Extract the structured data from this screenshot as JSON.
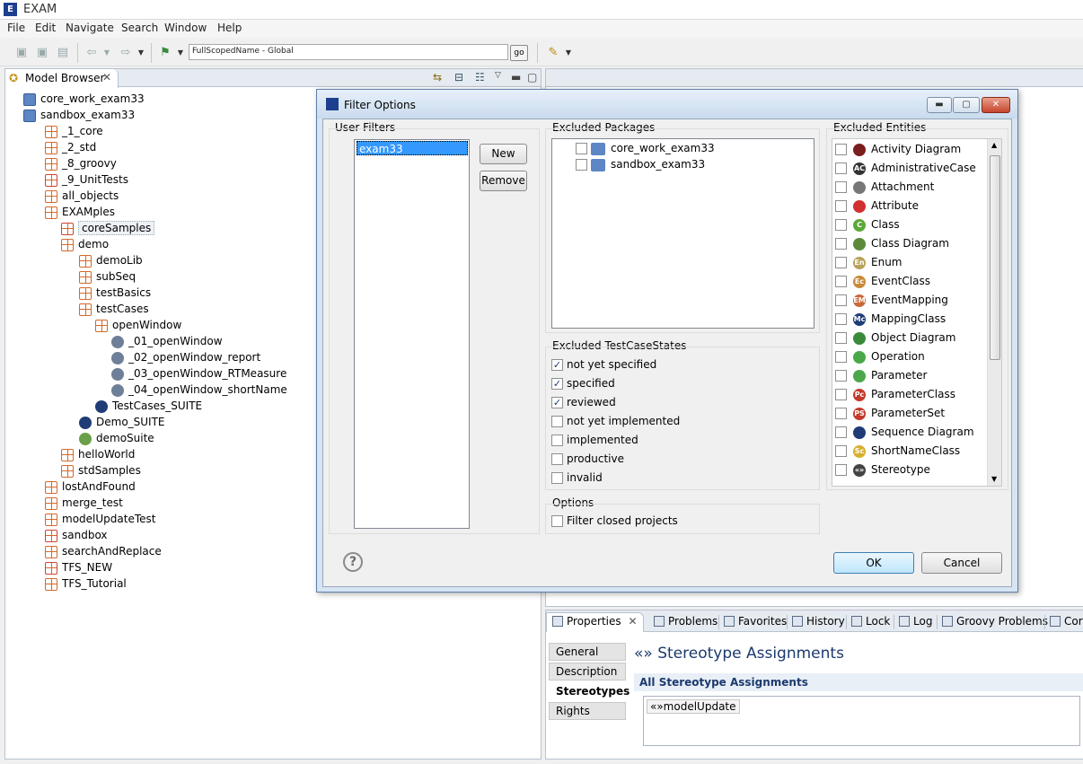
{
  "window": {
    "title": "EXAM"
  },
  "menu": [
    "File",
    "Edit",
    "Navigate",
    "Search",
    "Window",
    "Help"
  ],
  "toolbar": {
    "scope_value": "FullScopedName - Global",
    "go_label": "go"
  },
  "model_browser": {
    "tab_label": "Model Browser",
    "tree": [
      {
        "label": "core_work_exam33",
        "icon": "project-icon"
      },
      {
        "label": "sandbox_exam33",
        "icon": "project-icon"
      },
      {
        "label": "_1_core",
        "icon": "package-icon"
      },
      {
        "label": "_2_std",
        "icon": "package-icon"
      },
      {
        "label": "_8_groovy",
        "icon": "package-icon"
      },
      {
        "label": "_9_UnitTests",
        "icon": "package-locked-icon"
      },
      {
        "label": "all_objects",
        "icon": "package-icon"
      },
      {
        "label": "EXAMples",
        "icon": "package-icon"
      },
      {
        "label": "coreSamples",
        "icon": "package-locked-icon"
      },
      {
        "label": "demo",
        "icon": "package-icon"
      },
      {
        "label": "demoLib",
        "icon": "package-icon"
      },
      {
        "label": "subSeq",
        "icon": "package-icon"
      },
      {
        "label": "testBasics",
        "icon": "package-icon"
      },
      {
        "label": "testCases",
        "icon": "package-icon"
      },
      {
        "label": "openWindow",
        "icon": "package-icon"
      },
      {
        "label": "_01_openWindow",
        "icon": "testcase-icon"
      },
      {
        "label": "_02_openWindow_report",
        "icon": "testcase-icon"
      },
      {
        "label": "_03_openWindow_RTMeasure",
        "icon": "testcase-icon"
      },
      {
        "label": "_04_openWindow_shortName",
        "icon": "testcase-icon"
      },
      {
        "label": "TestCases_SUITE",
        "icon": "testsuite-icon"
      },
      {
        "label": "Demo_SUITE",
        "icon": "testsuite-icon"
      },
      {
        "label": "demoSuite",
        "icon": "suite-diagram-icon"
      },
      {
        "label": "helloWorld",
        "icon": "package-icon"
      },
      {
        "label": "stdSamples",
        "icon": "package-icon"
      },
      {
        "label": "lostAndFound",
        "icon": "package-icon"
      },
      {
        "label": "merge_test",
        "icon": "package-icon"
      },
      {
        "label": "modelUpdateTest",
        "icon": "package-icon"
      },
      {
        "label": "sandbox",
        "icon": "package-locked-icon"
      },
      {
        "label": "searchAndReplace",
        "icon": "package-icon"
      },
      {
        "label": "TFS_NEW",
        "icon": "package-locked-icon"
      },
      {
        "label": "TFS_Tutorial",
        "icon": "package-icon"
      }
    ]
  },
  "dialog": {
    "title": "Filter Options",
    "user_filters": {
      "label": "User Filters",
      "items": [
        "exam33"
      ],
      "new_label": "New",
      "remove_label": "Remove"
    },
    "excluded_packages": {
      "label": "Excluded Packages",
      "items": [
        "core_work_exam33",
        "sandbox_exam33"
      ]
    },
    "testcase_states": {
      "label": "Excluded TestCaseStates",
      "items": [
        {
          "label": "not yet specified",
          "checked": true
        },
        {
          "label": "specified",
          "checked": true
        },
        {
          "label": "reviewed",
          "checked": true
        },
        {
          "label": "not yet implemented",
          "checked": false
        },
        {
          "label": "implemented",
          "checked": false
        },
        {
          "label": "productive",
          "checked": false
        },
        {
          "label": "invalid",
          "checked": false
        }
      ]
    },
    "options": {
      "label": "Options",
      "filter_closed_label": "Filter closed projects"
    },
    "excluded_entities": {
      "label": "Excluded Entities",
      "items": [
        {
          "label": "Activity Diagram",
          "icon": "activity-diagram-icon",
          "color": "#7a1e1e",
          "glyph": ""
        },
        {
          "label": "AdministrativeCase",
          "icon": "administrative-case-icon",
          "color": "#333333",
          "glyph": "AC"
        },
        {
          "label": "Attachment",
          "icon": "paperclip-icon",
          "color": "#777777",
          "glyph": ""
        },
        {
          "label": "Attribute",
          "icon": "attribute-icon",
          "color": "#d03030",
          "glyph": ""
        },
        {
          "label": "Class",
          "icon": "class-icon",
          "color": "#5aa83a",
          "glyph": "C"
        },
        {
          "label": "Class Diagram",
          "icon": "class-diagram-icon",
          "color": "#5a8a3a",
          "glyph": ""
        },
        {
          "label": "Enum",
          "icon": "enum-icon",
          "color": "#b8a35a",
          "glyph": "En"
        },
        {
          "label": "EventClass",
          "icon": "event-class-icon",
          "color": "#c98a3a",
          "glyph": "Ec"
        },
        {
          "label": "EventMapping",
          "icon": "event-mapping-icon",
          "color": "#c96a3a",
          "glyph": "EM"
        },
        {
          "label": "MappingClass",
          "icon": "mapping-class-icon",
          "color": "#1f3c77",
          "glyph": "Mc"
        },
        {
          "label": "Object Diagram",
          "icon": "object-diagram-icon",
          "color": "#3a8a3a",
          "glyph": ""
        },
        {
          "label": "Operation",
          "icon": "operation-icon",
          "color": "#4aa84a",
          "glyph": ""
        },
        {
          "label": "Parameter",
          "icon": "parameter-icon",
          "color": "#4aa84a",
          "glyph": ""
        },
        {
          "label": "ParameterClass",
          "icon": "parameter-class-icon",
          "color": "#c43a2a",
          "glyph": "Pc"
        },
        {
          "label": "ParameterSet",
          "icon": "parameter-set-icon",
          "color": "#c43a2a",
          "glyph": "PS"
        },
        {
          "label": "Sequence Diagram",
          "icon": "sequence-diagram-icon",
          "color": "#1f3c77",
          "glyph": ""
        },
        {
          "label": "ShortNameClass",
          "icon": "short-name-class-icon",
          "color": "#d8b030",
          "glyph": "Sc"
        },
        {
          "label": "Stereotype",
          "icon": "stereotype-icon",
          "color": "#444444",
          "glyph": "«»"
        }
      ]
    },
    "ok_label": "OK",
    "cancel_label": "Cancel"
  },
  "properties": {
    "tabs": [
      "Properties",
      "Problems",
      "Favorites",
      "History",
      "Lock",
      "Log",
      "Groovy Problems",
      "Cor"
    ],
    "side_tabs": [
      "General",
      "Description",
      "Stereotypes",
      "Rights"
    ],
    "active_side_tab": "Stereotypes",
    "heading": "«» Stereotype Assignments",
    "subheading": "All Stereotype Assignments",
    "assignments": [
      "«»modelUpdate"
    ]
  }
}
